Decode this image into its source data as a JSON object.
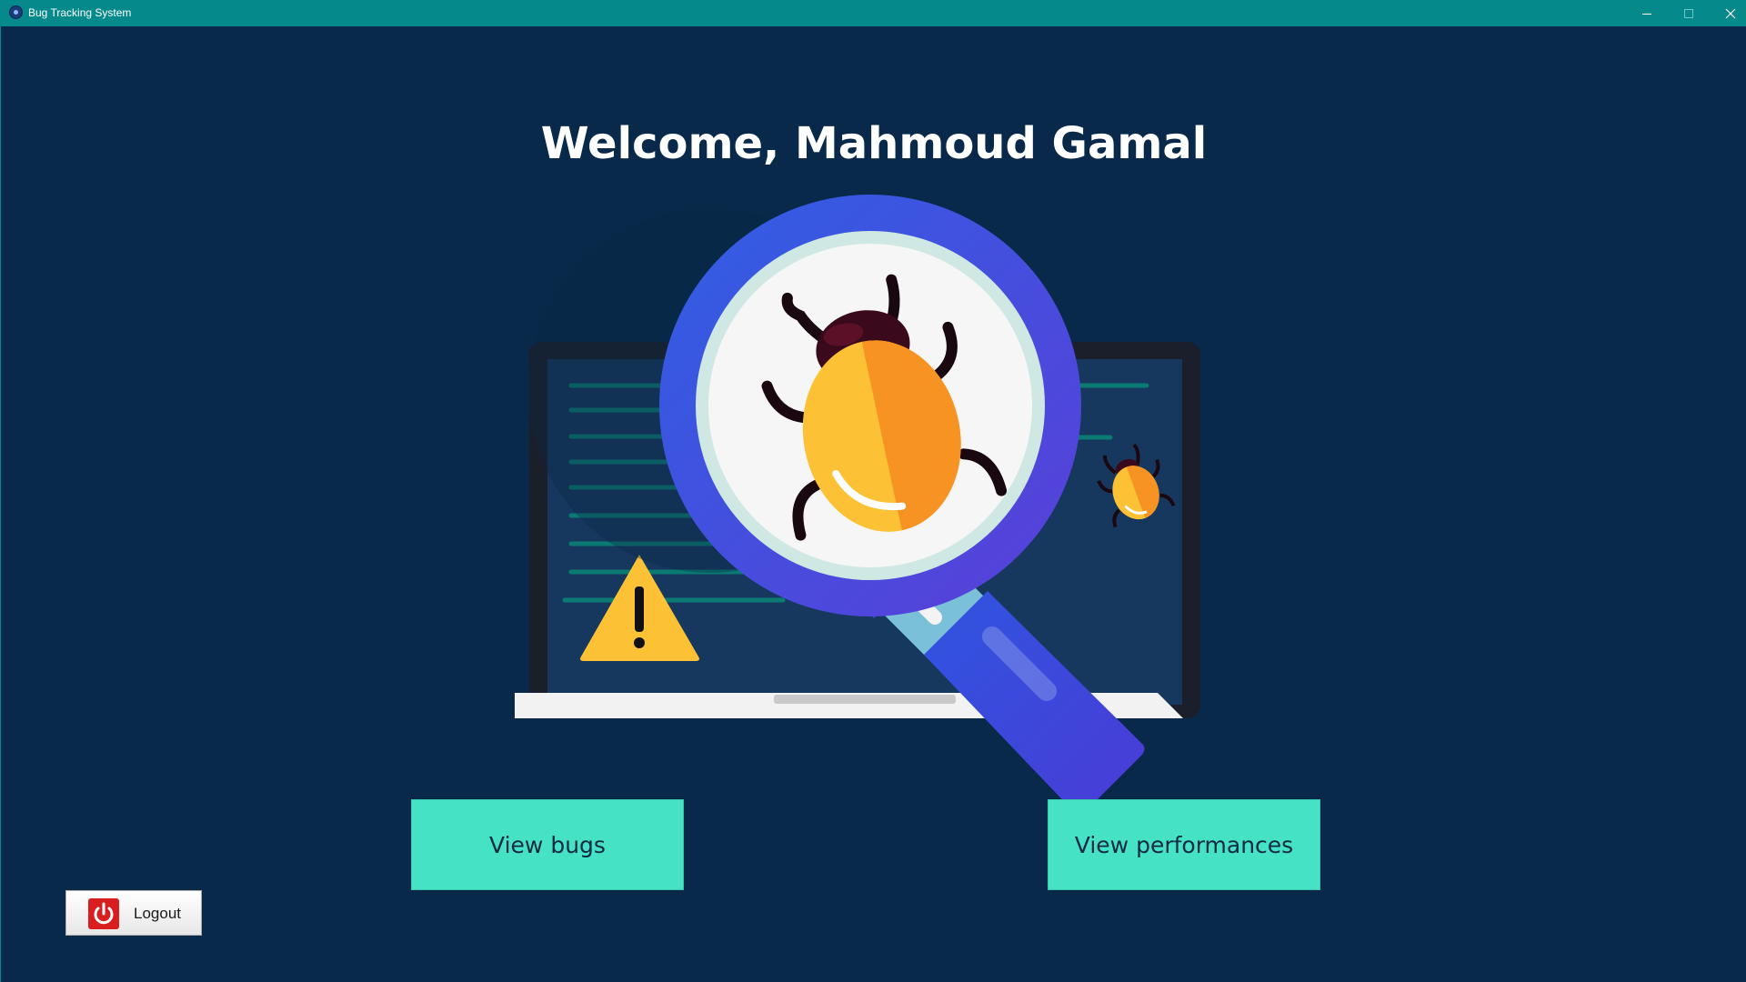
{
  "window": {
    "title": "Bug Tracking System",
    "controls": {
      "minimize_icon": "minimize-icon",
      "maximize_icon": "maximize-icon",
      "close_icon": "close-icon"
    }
  },
  "main": {
    "welcome_text": "Welcome, Mahmoud Gamal",
    "illustration_icon": "bug-search-illustration",
    "buttons": {
      "view_bugs": "View bugs",
      "view_performances": "View performances"
    },
    "logout": {
      "label": "Logout",
      "icon": "power-icon"
    }
  },
  "colors": {
    "titlebar": "#05898b",
    "background": "#08294a",
    "accent_button": "#45e2c6",
    "logout_icon": "#d81e1e"
  }
}
